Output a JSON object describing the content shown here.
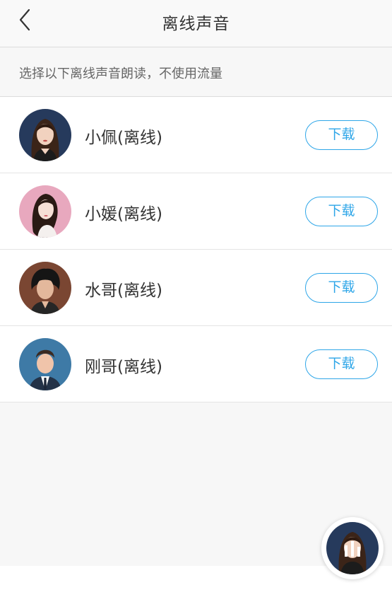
{
  "header": {
    "title": "离线声音"
  },
  "hint": "选择以下离线声音朗读，不使用流量",
  "voices": [
    {
      "name": "小佩(离线)",
      "button": "下载"
    },
    {
      "name": "小媛(离线)",
      "button": "下载"
    },
    {
      "name": "水哥(离线)",
      "button": "下载"
    },
    {
      "name": "刚哥(离线)",
      "button": "下载"
    }
  ],
  "colors": {
    "accent": "#2ea6e8",
    "text": "#333333",
    "hint": "#666666"
  }
}
